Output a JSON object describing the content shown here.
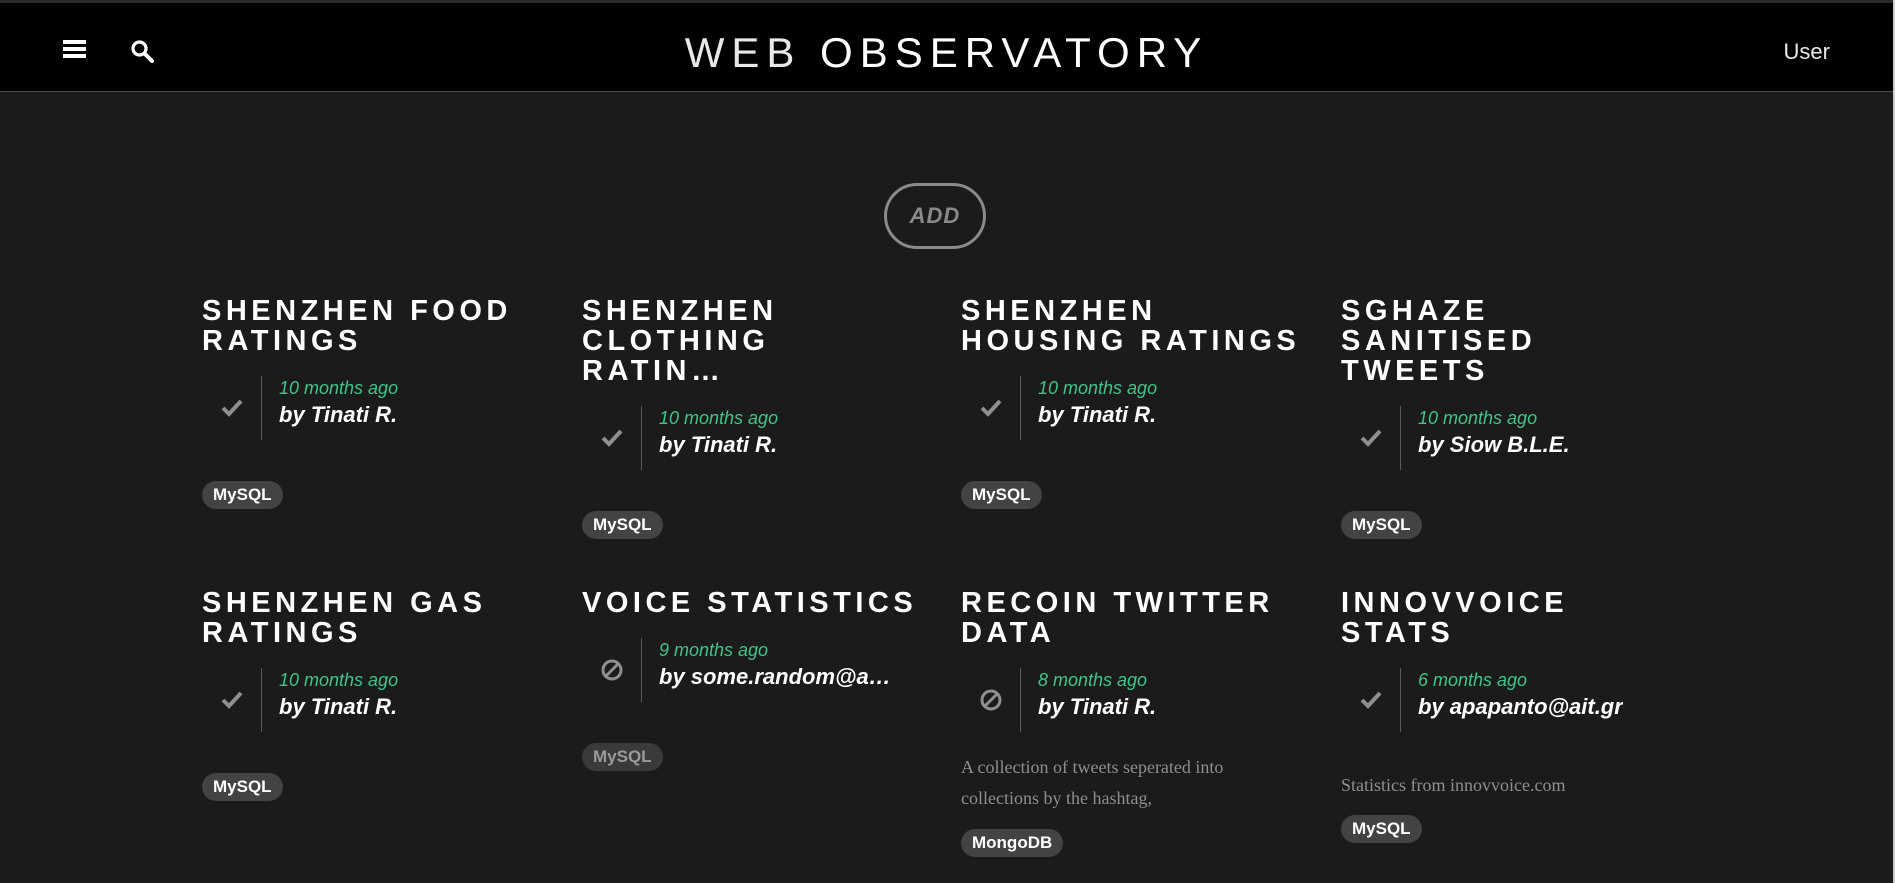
{
  "header": {
    "brand_light": "WEB",
    "brand_bold": "OBSERVATORY",
    "user_label": "User",
    "menu_icon": "hamburger-menu-icon",
    "search_icon": "search-icon"
  },
  "add_button": {
    "label": "ADD"
  },
  "colors": {
    "accent_green": "#3fc58a",
    "background": "#1b1b1b",
    "topbar": "#000000",
    "tag_bg": "#434343"
  },
  "cards": [
    {
      "title": "SHENZHEN FOOD RATINGS",
      "status_icon": "check-icon",
      "time": "10 months ago",
      "author": "by Tinati R.",
      "description": "",
      "tag": "MySQL"
    },
    {
      "title": "SHENZHEN CLOTHING RATIN…",
      "status_icon": "check-icon",
      "time": "10 months ago",
      "author": "by Tinati R.",
      "description": "",
      "tag": "MySQL"
    },
    {
      "title": "SHENZHEN HOUSING RATINGS",
      "status_icon": "check-icon",
      "time": "10 months ago",
      "author": "by Tinati R.",
      "description": "",
      "tag": "MySQL"
    },
    {
      "title": "SGHAZE SANITISED TWEETS",
      "status_icon": "check-icon",
      "time": "10 months ago",
      "author": "by Siow B.L.E.",
      "description": "",
      "tag": "MySQL"
    },
    {
      "title": "SHENZHEN GAS RATINGS",
      "status_icon": "check-icon",
      "time": "10 months ago",
      "author": "by Tinati R.",
      "description": "",
      "tag": "MySQL"
    },
    {
      "title": "VOICE STATISTICS",
      "status_icon": "blocked-icon",
      "time": "9 months ago",
      "author": "by some.random@ad…",
      "description": "",
      "tag": "MySQL"
    },
    {
      "title": "RECOIN TWITTER DATA",
      "status_icon": "blocked-icon",
      "time": "8 months ago",
      "author": "by Tinati R.",
      "description": "A collection of tweets seperated into collections by the hashtag,",
      "tag": "MongoDB"
    },
    {
      "title": "INNOVVOICE STATS",
      "status_icon": "check-icon",
      "time": "6 months ago",
      "author": "by apapanto@ait.gr",
      "description": "Statistics from innovvoice.com",
      "tag": "MySQL"
    }
  ]
}
